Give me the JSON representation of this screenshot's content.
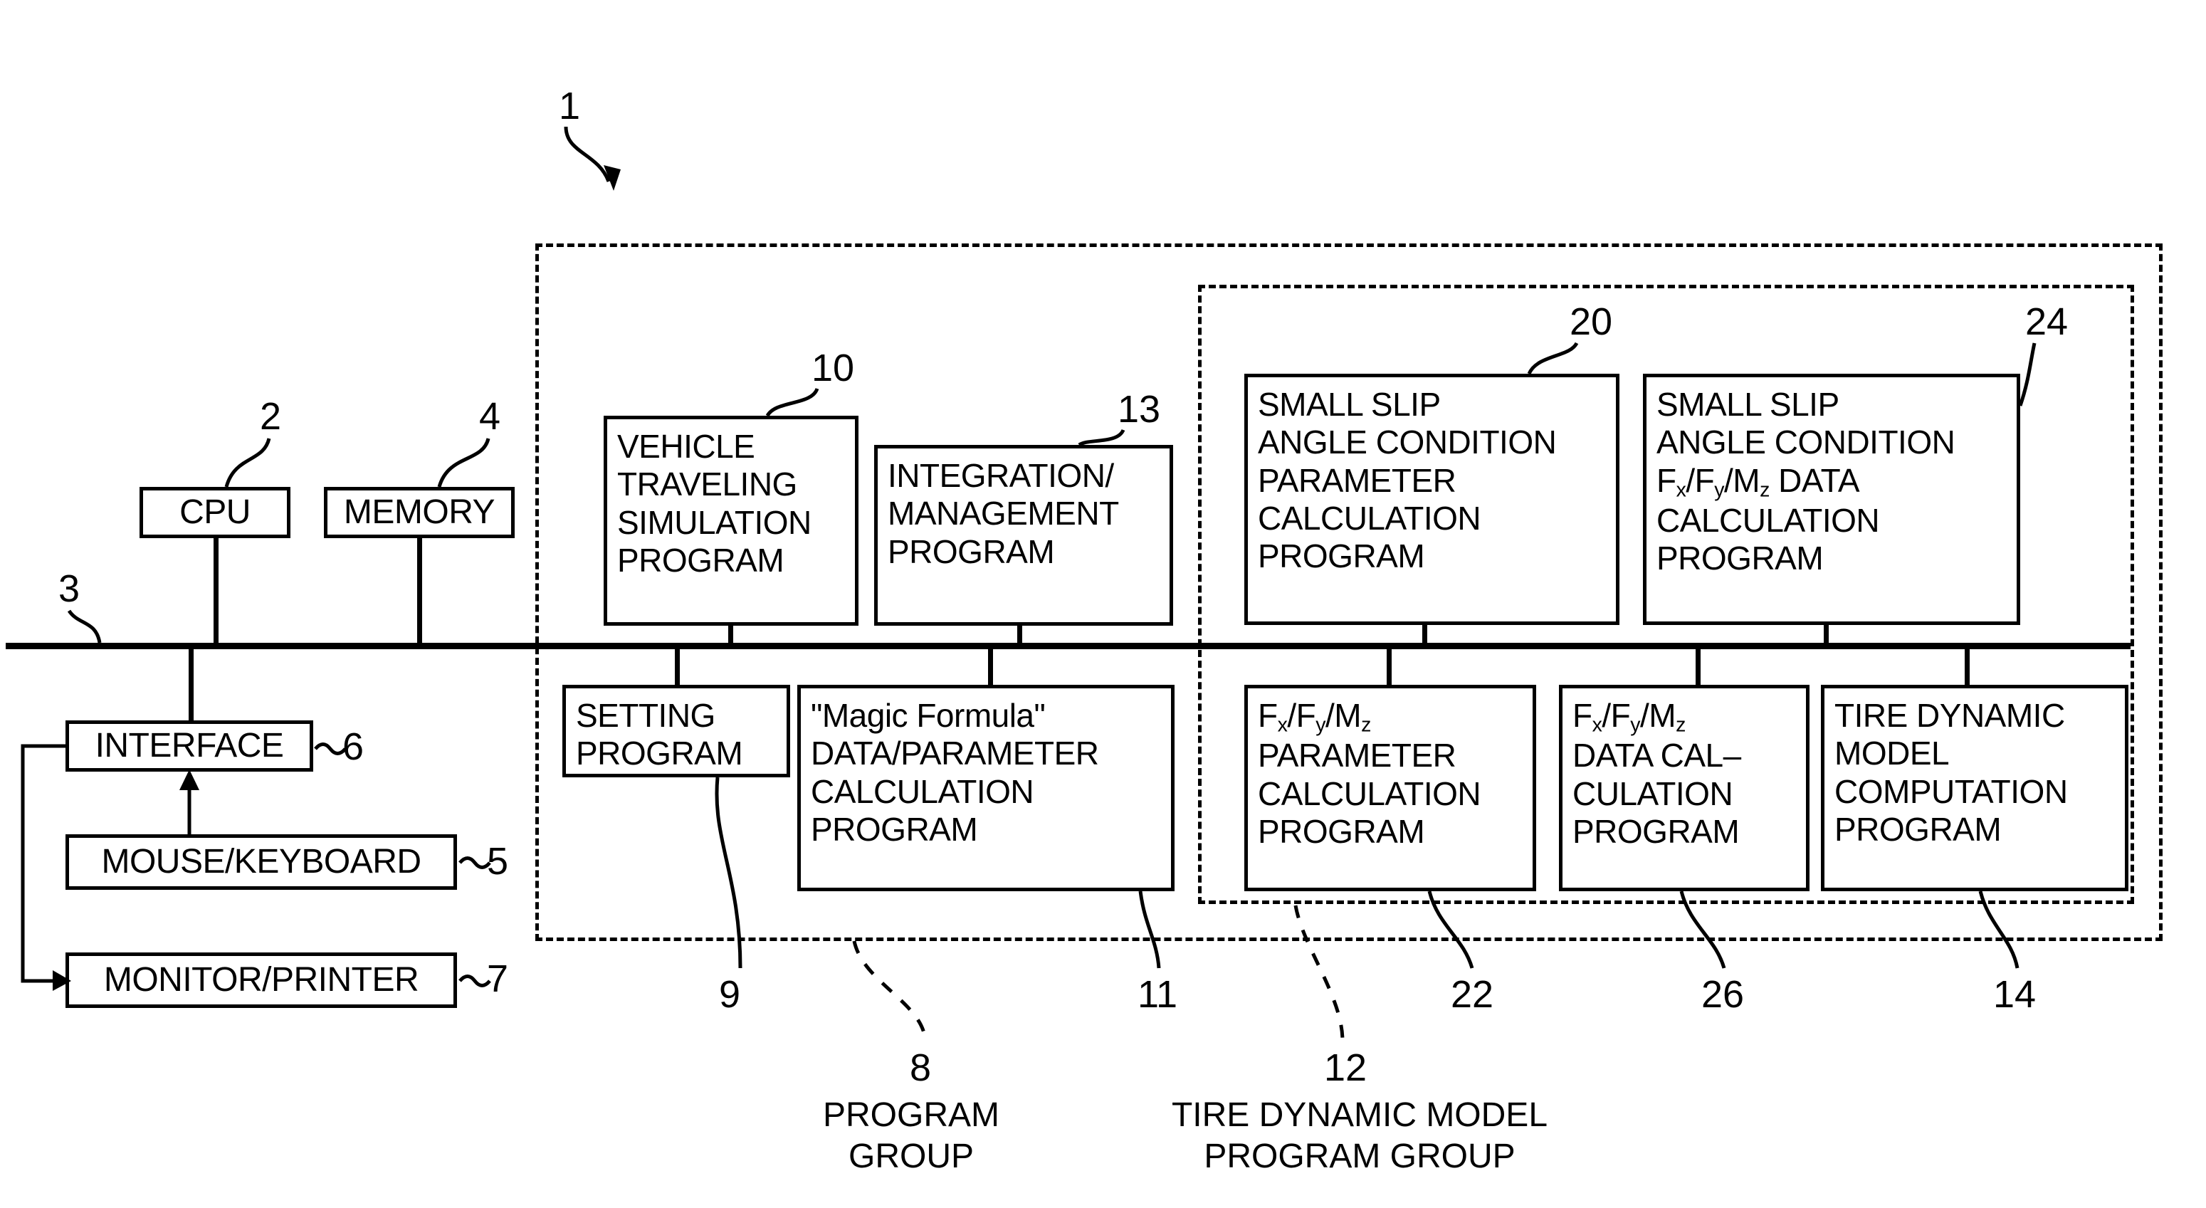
{
  "figure": {
    "system_ref": "1",
    "hardware": {
      "cpu": {
        "label": "CPU",
        "ref": "2"
      },
      "memory": {
        "label": "MEMORY",
        "ref": "4"
      },
      "bus_ref": "3",
      "interface": {
        "label": "INTERFACE",
        "ref": "6"
      },
      "mouse_keyboard": {
        "label": "MOUSE/KEYBOARD",
        "ref": "5"
      },
      "monitor_printer": {
        "label": "MONITOR/PRINTER",
        "ref": "7"
      }
    },
    "program_group": {
      "ref": "8",
      "caption": "PROGRAM\nGROUP",
      "vehicle_traveling_simulation": {
        "label": "VEHICLE\nTRAVELING\nSIMULATION\nPROGRAM",
        "ref": "10"
      },
      "integration_management": {
        "label": "INTEGRATION/\nMANAGEMENT\nPROGRAM",
        "ref": "13"
      },
      "setting_program": {
        "label": "SETTING\nPROGRAM",
        "ref": "9"
      },
      "magic_formula": {
        "label": "\"Magic Formula\"\nDATA/PARAMETER\nCALCULATION\nPROGRAM",
        "ref": "11"
      }
    },
    "tire_dynamic_model_group": {
      "ref": "12",
      "caption": "TIRE DYNAMIC MODEL\nPROGRAM GROUP",
      "small_slip_parameter": {
        "label": "SMALL SLIP\nANGLE CONDITION\nPARAMETER\nCALCULATION\nPROGRAM",
        "ref": "20"
      },
      "small_slip_data": {
        "line1": "SMALL SLIP",
        "line2": "ANGLE CONDITION",
        "line3_prefix": "F",
        "line3_sub1": "x",
        "line3_mid1": "/F",
        "line3_sub2": "y",
        "line3_mid2": "/M",
        "line3_sub3": "z",
        "line3_suffix": " DATA",
        "line4": "CALCULATION",
        "line5": "PROGRAM",
        "ref": "24"
      },
      "fxfymz_parameter": {
        "line1_prefix": "F",
        "line1_sub1": "x",
        "line1_mid1": "/F",
        "line1_sub2": "y",
        "line1_mid2": "/M",
        "line1_sub3": "z",
        "line2": "PARAMETER",
        "line3": "CALCULATION",
        "line4": "PROGRAM",
        "ref": "22"
      },
      "fxfymz_data": {
        "line1_prefix": "F",
        "line1_sub1": "x",
        "line1_mid1": "/F",
        "line1_sub2": "y",
        "line1_mid2": "/M",
        "line1_sub3": "z",
        "line2": "DATA CAL–",
        "line3": "CULATION",
        "line4": "PROGRAM",
        "ref": "26"
      },
      "tire_dynamic_model_computation": {
        "label": "TIRE DYNAMIC\nMODEL\nCOMPUTATION\nPROGRAM",
        "ref": "14"
      }
    }
  }
}
